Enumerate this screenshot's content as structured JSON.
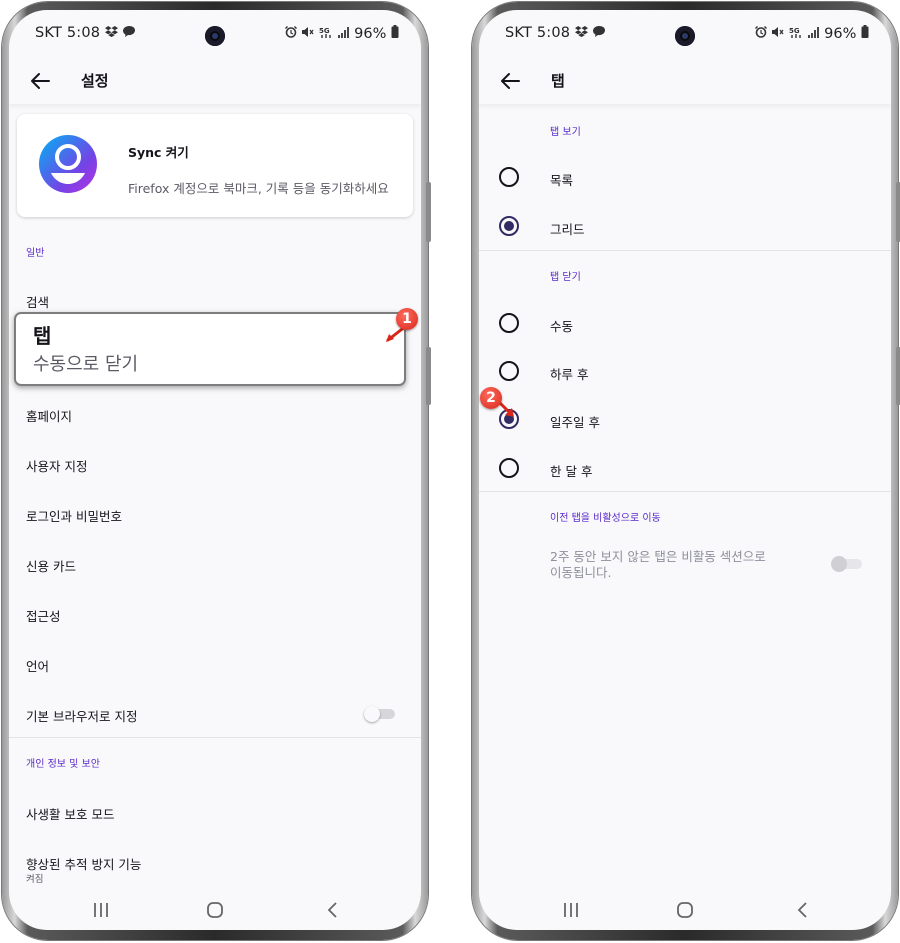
{
  "status_bar": {
    "carrier_time": "SKT 5:08",
    "battery": "96%"
  },
  "left_screen": {
    "title": "설정",
    "sync": {
      "title": "Sync 켜기",
      "subtitle": "Firefox 계정으로 북마크, 기록 등을 동기화하세요"
    },
    "section_general": "일반",
    "items": {
      "search": "검색",
      "tabs": "탭",
      "tabs_summary": "수동으로 닫기",
      "homepage": "홈페이지",
      "customize": "사용자 지정",
      "logins": "로그인과 비밀번호",
      "credit_cards": "신용 카드",
      "accessibility": "접근성",
      "language": "언어",
      "default_browser": "기본 브라우저로 지정"
    },
    "section_privacy": "개인 정보 및 보안",
    "privacy_items": {
      "private_mode": "사생활 보호 모드",
      "etp": "향상된 추적 방지 기능",
      "etp_status": "켜짐"
    },
    "default_browser_enabled": false,
    "marker": "1"
  },
  "right_screen": {
    "title": "탭",
    "section_view": "탭 보기",
    "view_options": [
      "목록",
      "그리드"
    ],
    "view_selected": "그리드",
    "section_close": "탭 닫기",
    "close_options": [
      "수동",
      "하루 후",
      "일주일 후",
      "한 달 후"
    ],
    "close_selected": "일주일 후",
    "section_inactive": "이전 탭을 비활성으로 이동",
    "inactive_desc_line1": "2주 동안 보지 않은 탭은 비활동 섹션으로",
    "inactive_desc_line2": "이동됩니다.",
    "inactive_enabled": false,
    "marker": "2"
  },
  "icons": [
    "back-arrow-icon",
    "dropbox-icon",
    "chat-bubble-icon",
    "alarm-icon",
    "mute-icon",
    "5g-icon",
    "signal-icon",
    "battery-icon",
    "recent-apps-icon",
    "home-icon",
    "back-nav-icon",
    "account-avatar-icon"
  ],
  "colors": {
    "accent": "#592acb",
    "radio_checked": "#312a65",
    "marker": "#e0301f"
  }
}
